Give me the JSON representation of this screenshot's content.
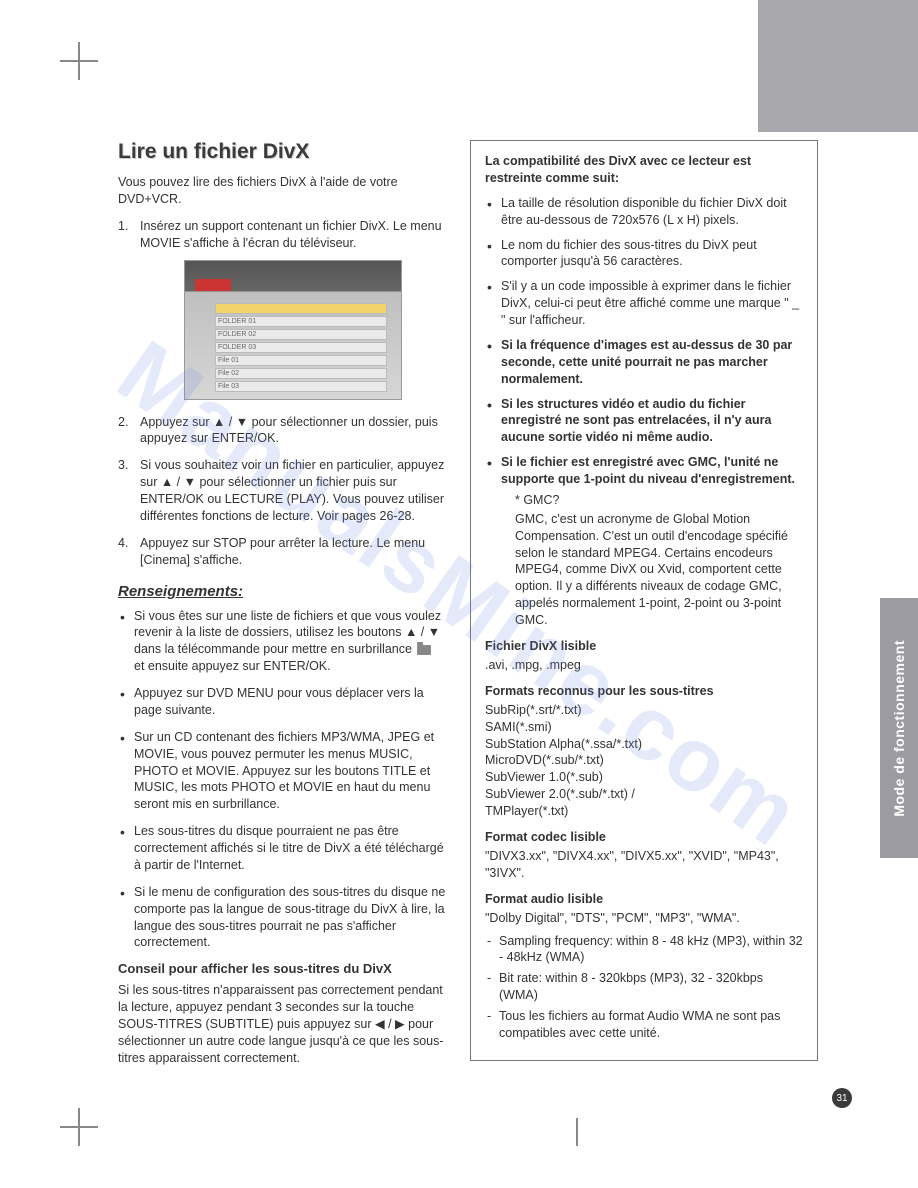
{
  "sideTab": "Mode de fonctionnement",
  "pageNumber": "31",
  "watermark": "ManualsMine.com",
  "left": {
    "title": "Lire un fichier DivX",
    "intro": "Vous pouvez lire des fichiers DivX à l'aide de votre DVD+VCR.",
    "steps": [
      "Insérez un support contenant un fichier DivX. Le menu MOVIE s'affiche à l'écran du téléviseur.",
      "Appuyez sur ▲ / ▼ pour sélectionner un dossier, puis appuyez sur ENTER/OK.",
      "Si vous souhaitez voir un fichier en particulier, appuyez sur  ▲ / ▼ pour sélectionner un fichier puis sur ENTER/OK ou LECTURE (PLAY). Vous pouvez utiliser différentes fonctions de lecture. Voir pages 26-28.",
      "Appuyez sur STOP pour arrêter la lecture. Le menu [Cinema] s'affiche."
    ],
    "screenshotRows": [
      "",
      "FOLDER 01",
      "FOLDER 02",
      "FOLDER 03",
      "File 01",
      "File 02",
      "File 03"
    ],
    "renseignements": "Renseignements:",
    "rens_items": [
      "Si vous êtes sur une liste de fichiers et que vous voulez revenir à la liste de dossiers, utilisez les boutons ▲ / ▼ dans la télécommande pour mettre en surbrillance  ⌂  et ensuite appuyez sur ENTER/OK.",
      "Appuyez sur DVD MENU pour vous déplacer vers la page suivante.",
      "Sur un CD contenant des fichiers MP3/WMA, JPEG et MOVIE, vous pouvez permuter les menus MUSIC, PHOTO et MOVIE. Appuyez sur les boutons TITLE et MUSIC, les mots PHOTO et MOVIE en haut du menu seront mis en surbrillance.",
      "Les sous-titres du disque pourraient ne pas être correctement affichés si le titre de DivX a été téléchargé à partir de l'Internet.",
      "Si le menu de configuration des sous-titres du disque ne comporte pas la langue de sous-titrage du DivX à lire, la langue des sous-titres pourrait ne pas s'afficher correctement."
    ],
    "tipTitle": "Conseil pour afficher les sous-titres du DivX",
    "tipBody": "Si les sous-titres n'apparaissent pas correctement pendant la lecture, appuyez pendant 3 secondes sur la touche SOUS-TITRES (SUBTITLE) puis appuyez sur ◀ / ▶ pour sélectionner un autre code langue jusqu'à ce que les sous-titres apparaissent correctement."
  },
  "right": {
    "lead": "La compatibilité des DivX avec ce lecteur est restreinte comme suit:",
    "items": [
      {
        "t": "La taille de résolution disponible du fichier DivX doit être au-dessous de 720x576 (L x H)  pixels.",
        "b": false
      },
      {
        "t": "Le nom du fichier des sous-titres du DivX peut comporter jusqu'à 56 caractères.",
        "b": false
      },
      {
        "t": "S'il y a un code impossible à exprimer dans le fichier DivX, celui-ci peut être affiché comme une marque \" _ \" sur l'afficheur.",
        "b": false
      },
      {
        "t": "Si la fréquence d'images est au-dessus de 30 par seconde, cette unité pourrait ne pas marcher normalement.",
        "b": true
      },
      {
        "t": "Si les structures vidéo et audio du fichier enregistré ne sont pas entrelacées, il n'y aura aucune sortie vidéo ni même audio.",
        "b": true
      },
      {
        "t": "Si le fichier est enregistré avec GMC, l'unité ne supporte que 1-point du niveau d'enregistrement.",
        "b": true
      }
    ],
    "gmcLabel": "* GMC?",
    "gmcBody": "GMC, c'est un acronyme de Global Motion Compensation. C'est un outil d'encodage spécifié selon le standard MPEG4. Certains encodeurs MPEG4, comme DivX ou Xvid, comportent cette option. Il y a différents niveaux de codage GMC, appelés normalement 1-point, 2-point ou 3-point GMC.",
    "h_file": "Fichier DivX lisible",
    "fileList": ".avi, .mpg, .mpeg",
    "h_subs": "Formats reconnus pour les sous-titres",
    "subsList": "SubRip(*.srt/*.txt)\nSAMI(*.smi)\nSubStation Alpha(*.ssa/*.txt)\nMicroDVD(*.sub/*.txt)\nSubViewer 1.0(*.sub)\nSubViewer 2.0(*.sub/*.txt) /\nTMPlayer(*.txt)",
    "h_codec": "Format codec lisible",
    "codecList": "\"DIVX3.xx\", \"DIVX4.xx\", \"DIVX5.xx\", \"XVID\", \"MP43\", \"3IVX\".",
    "h_audio": "Format audio lisible",
    "audioLine": "\"Dolby Digital\", \"DTS\", \"PCM\", \"MP3\", \"WMA\".",
    "audioItems": [
      "Sampling frequency: within 8 - 48 kHz (MP3), within 32 - 48kHz (WMA)",
      "Bit rate: within 8 - 320kbps (MP3), 32 - 320kbps (WMA)",
      "Tous les fichiers au format Audio WMA ne sont pas compatibles avec cette unité."
    ]
  }
}
